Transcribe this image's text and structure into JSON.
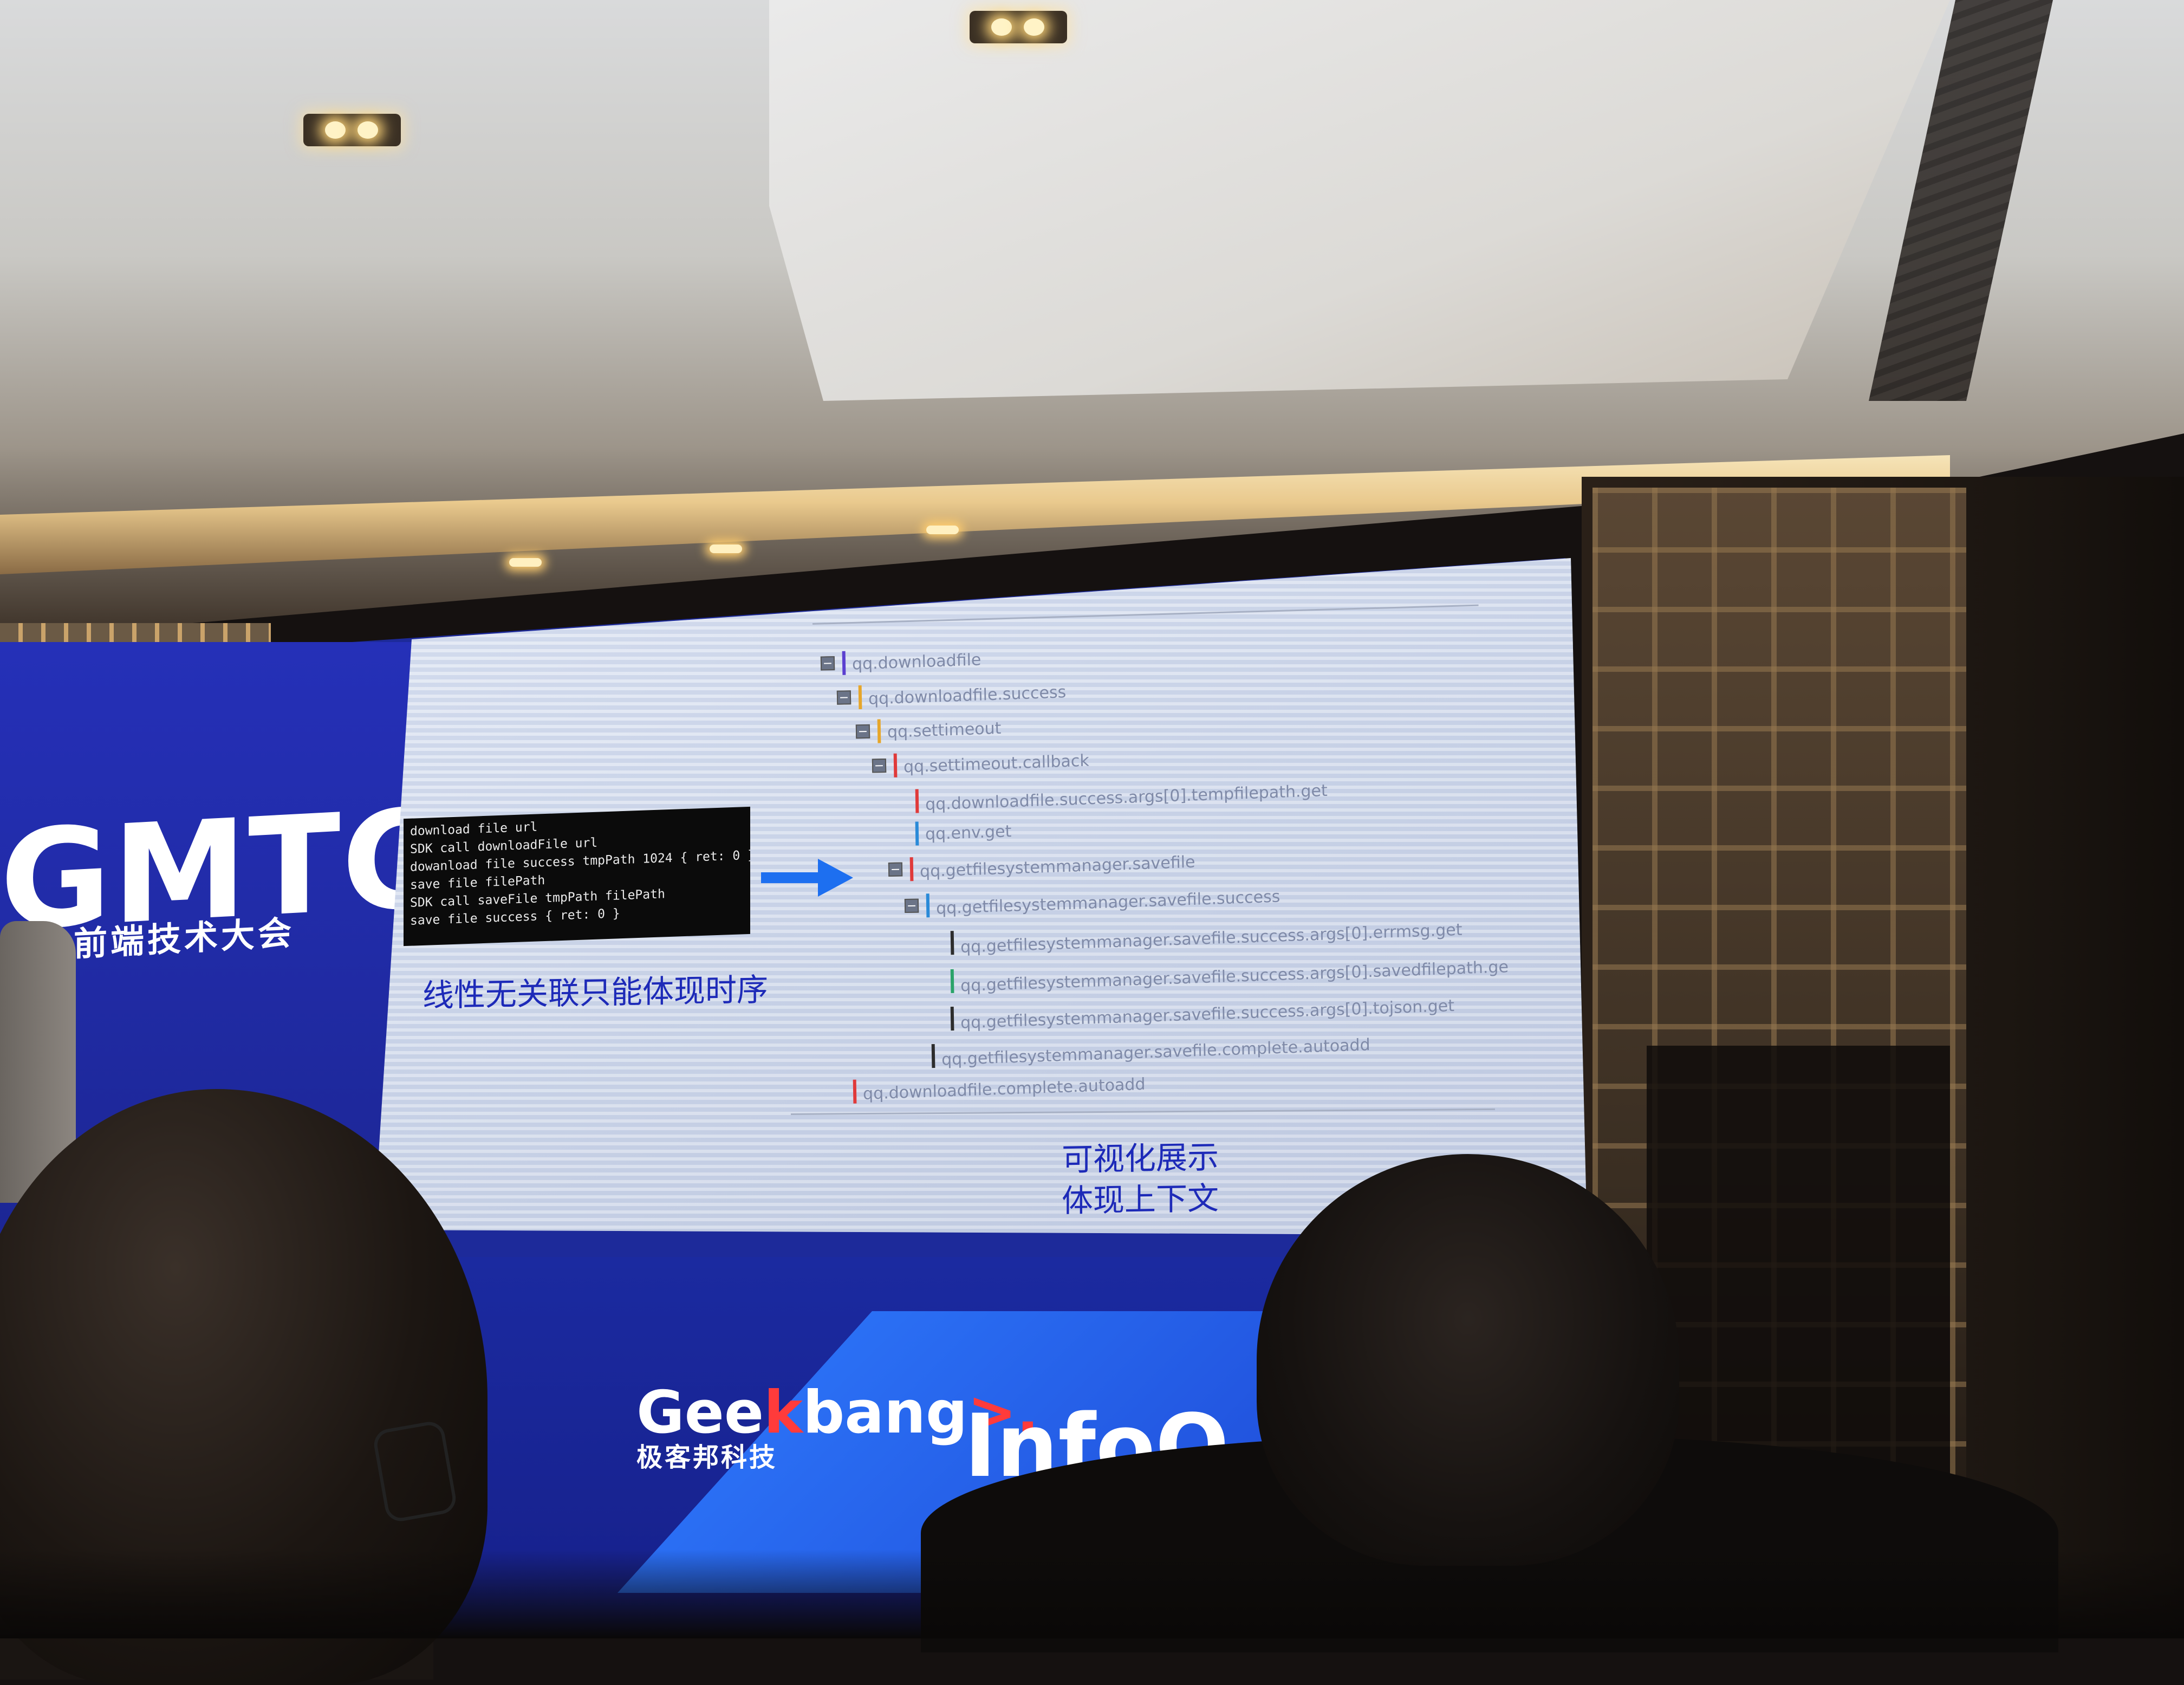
{
  "brand": {
    "event": "GMTC",
    "event_subtitle": "球大前端技术大会",
    "sponsor_name_pre": "Gee",
    "sponsor_name_k": "k",
    "sponsor_name_post": "bang",
    "sponsor_mark": ">.",
    "sponsor_cn": "极客邦科技",
    "partner": "InfoQ"
  },
  "terminal": {
    "lines": [
      "download file url",
      "SDK call downloadFile url",
      "dowanload file success tmpPath 1024 { ret: 0 }",
      "save file filePath",
      "SDK call saveFile tmpPath filePath",
      "save file success { ret: 0 }"
    ]
  },
  "slide": {
    "caption_left": "线性无关联只能体现时序",
    "caption_right_line1": "可视化展示",
    "caption_right_line2": "体现上下文"
  },
  "tree": {
    "toggle_symbol": "−",
    "nodes": [
      {
        "label": "qq.downloadfile",
        "color": "#5b3fd0",
        "toggle": true
      },
      {
        "label": "qq.downloadfile.success",
        "color": "#e6a62a",
        "toggle": true
      },
      {
        "label": "qq.settimeout",
        "color": "#e6a62a",
        "toggle": true
      },
      {
        "label": "qq.settimeout.callback",
        "color": "#e03a3a",
        "toggle": true
      },
      {
        "label": "qq.downloadfile.success.args[0].tempfilepath.get",
        "color": "#e03a3a",
        "toggle": false
      },
      {
        "label": "qq.env.get",
        "color": "#2a8ad8",
        "toggle": false
      },
      {
        "label": "qq.getfilesystemmanager.savefile",
        "color": "#e03a3a",
        "toggle": true
      },
      {
        "label": "qq.getfilesystemmanager.savefile.success",
        "color": "#2a8ad8",
        "toggle": true
      },
      {
        "label": "qq.getfilesystemmanager.savefile.success.args[0].errmsg.get",
        "color": "#2d2d2d",
        "toggle": false
      },
      {
        "label": "qq.getfilesystemmanager.savefile.success.args[0].savedfilepath.ge",
        "color": "#2aa36a",
        "toggle": false
      },
      {
        "label": "qq.getfilesystemmanager.savefile.success.args[0].tojson.get",
        "color": "#2d2d2d",
        "toggle": false
      },
      {
        "label": "qq.getfilesystemmanager.savefile.complete.autoadd",
        "color": "#2d2d2d",
        "toggle": false
      },
      {
        "label": "qq.downloadfile.complete.autoadd",
        "color": "#e03a3a",
        "toggle": false
      }
    ]
  }
}
